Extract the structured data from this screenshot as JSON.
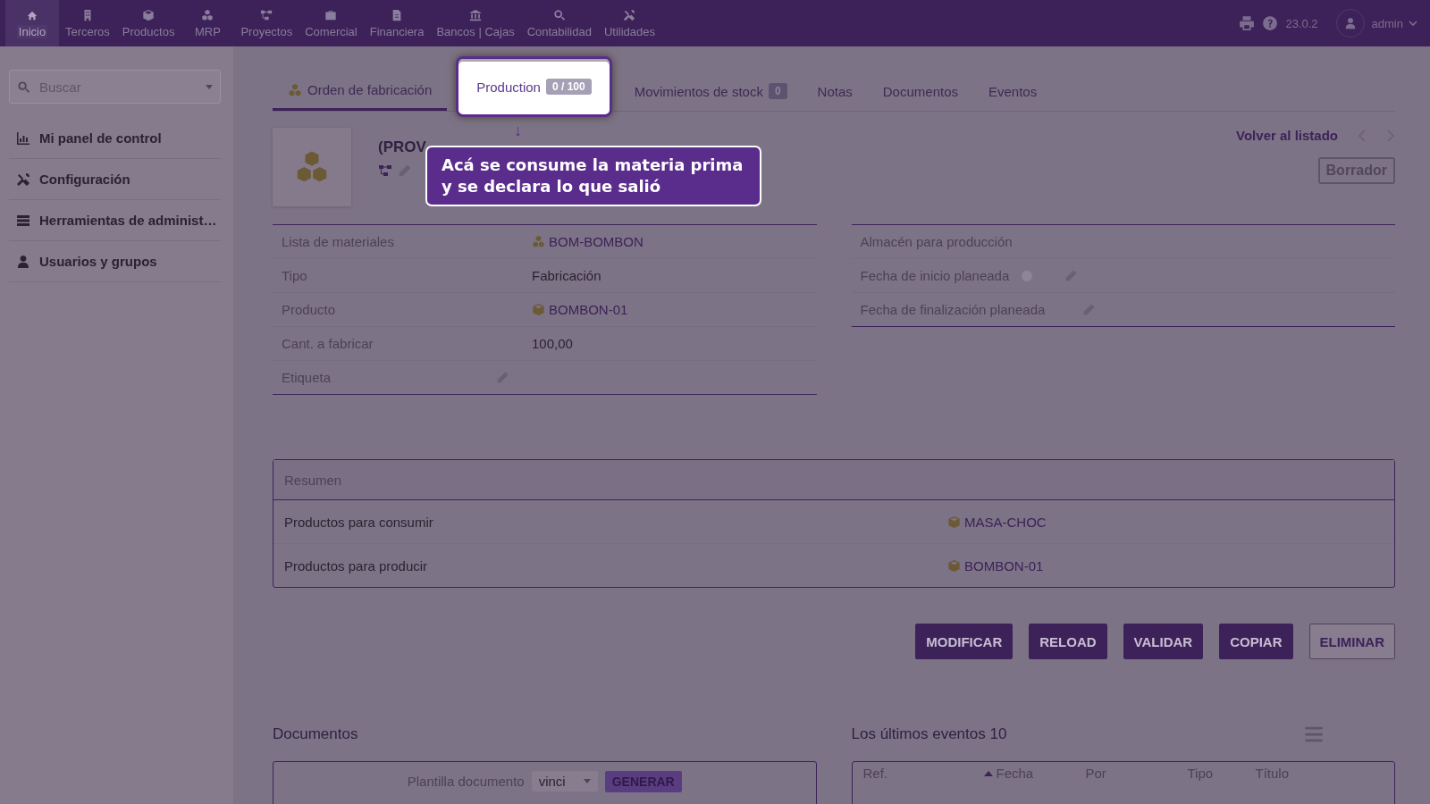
{
  "top_menu": {
    "items": [
      {
        "label": "Inicio",
        "selected": true
      },
      {
        "label": "Terceros",
        "selected": false
      },
      {
        "label": "Productos",
        "selected": false
      },
      {
        "label": "MRP",
        "selected": false
      },
      {
        "label": "Proyectos",
        "selected": false
      },
      {
        "label": "Comercial",
        "selected": false
      },
      {
        "label": "Financiera",
        "selected": false
      },
      {
        "label": "Bancos | Cajas",
        "selected": false
      },
      {
        "label": "Contabilidad",
        "selected": false
      },
      {
        "label": "Utilidades",
        "selected": false
      }
    ],
    "version": "23.0.2",
    "user": "admin"
  },
  "sidebar": {
    "search": {
      "placeholder": "Buscar"
    },
    "items": [
      {
        "label": "Mi panel de control"
      },
      {
        "label": "Configuración"
      },
      {
        "label": "Herramientas de administ…"
      },
      {
        "label": "Usuarios y grupos"
      }
    ]
  },
  "tabs": [
    {
      "label": "Orden de fabricación",
      "selected": true,
      "highlighted": false
    },
    {
      "label": "Production",
      "badge": "0 / 100",
      "selected": false,
      "highlighted": true
    },
    {
      "label": "Movimientos de stock",
      "badge": "0",
      "selected": false,
      "highlighted": false
    },
    {
      "label": "Notas",
      "selected": false,
      "highlighted": false
    },
    {
      "label": "Documentos",
      "selected": false,
      "highlighted": false
    },
    {
      "label": "Eventos",
      "selected": false,
      "highlighted": false
    }
  ],
  "tour": {
    "arrow": "↓",
    "text": "Acá se consume la materia prima y se declara lo que salió"
  },
  "record": {
    "title": "(PROV",
    "back_link": "Volver al listado",
    "status": "Borrador"
  },
  "fields_left": [
    {
      "label": "Lista de materiales",
      "value": "BOM-BOMBON",
      "kind": "bom_link",
      "editable": false
    },
    {
      "label": "Tipo",
      "value": "Fabricación",
      "kind": "text",
      "editable": false
    },
    {
      "label": "Producto",
      "value": "BOMBON-01",
      "kind": "product_link",
      "editable": false
    },
    {
      "label": "Cant. a fabricar",
      "value": "100,00",
      "kind": "text",
      "editable": false
    },
    {
      "label": "Etiqueta",
      "editable": true
    }
  ],
  "fields_right": [
    {
      "label": "Almacén para producción",
      "editable": false,
      "info": false
    },
    {
      "label": "Fecha de inicio planeada",
      "editable": true,
      "info": true
    },
    {
      "label": "Fecha de finalización planeada",
      "editable": true,
      "info": false
    }
  ],
  "summary": {
    "title": "Resumen",
    "rows": [
      {
        "label": "Productos para consumir",
        "value": "MASA-CHOC"
      },
      {
        "label": "Productos para producir",
        "value": "BOMBON-01"
      }
    ]
  },
  "buttons": [
    {
      "label": "MODIFICAR",
      "kind": "primary"
    },
    {
      "label": "RELOAD",
      "kind": "primary"
    },
    {
      "label": "VALIDAR",
      "kind": "primary"
    },
    {
      "label": "COPIAR",
      "kind": "primary"
    },
    {
      "label": "ELIMINAR",
      "kind": "outline"
    }
  ],
  "documents": {
    "title": "Documentos",
    "template_label": "Plantilla documento",
    "template_value": "vinci",
    "generate": "GENERAR"
  },
  "events": {
    "title": "Los últimos eventos 10",
    "columns": [
      {
        "label": "Ref.",
        "sorted": false
      },
      {
        "label": "Fecha",
        "sorted": true
      },
      {
        "label": "Por",
        "sorted": false
      },
      {
        "label": "Tipo",
        "sorted": false
      },
      {
        "label": "Título",
        "sorted": false
      }
    ]
  }
}
